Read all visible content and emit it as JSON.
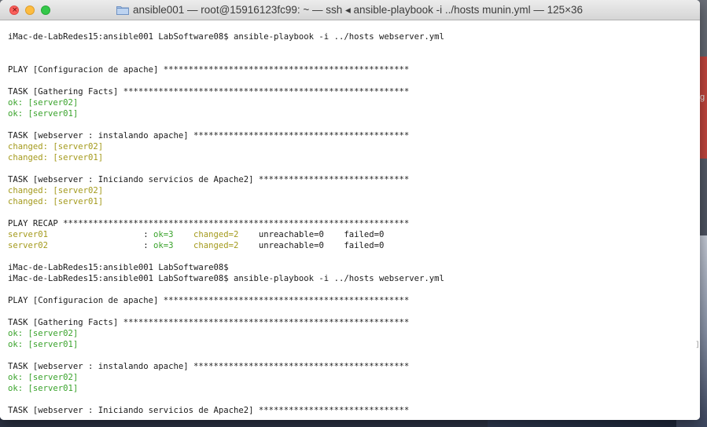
{
  "window": {
    "title": "ansible001 — root@15916123fc99: ~ — ssh ◂ ansible-playbook -i ../hosts munin.yml — 125×36",
    "close_glyph": "×"
  },
  "desktop": {
    "side_label": "g",
    "right_mark": "]"
  },
  "colors": {
    "ok": "#3aa32c",
    "changed": "#a49a1c",
    "text": "#1a1a1a"
  },
  "terminal": {
    "lines": [
      {
        "t": "iMac-de-LabRedes15:ansible001 LabSoftware08$ ansible-playbook -i ../hosts webserver.yml",
        "c": "plain"
      },
      {
        "t": "",
        "c": "plain"
      },
      {
        "t": "",
        "c": "plain"
      },
      {
        "t": "PLAY [Configuracion de apache] *************************************************",
        "c": "plain"
      },
      {
        "t": "",
        "c": "plain"
      },
      {
        "t": "TASK [Gathering Facts] *********************************************************",
        "c": "plain"
      },
      {
        "t": "ok: [server02]",
        "c": "ok"
      },
      {
        "t": "ok: [server01]",
        "c": "ok"
      },
      {
        "t": "",
        "c": "plain"
      },
      {
        "t": "TASK [webserver : instalando apache] *******************************************",
        "c": "plain"
      },
      {
        "t": "changed: [server02]",
        "c": "changed"
      },
      {
        "t": "changed: [server01]",
        "c": "changed"
      },
      {
        "t": "",
        "c": "plain"
      },
      {
        "t": "TASK [webserver : Iniciando servicios de Apache2] ******************************",
        "c": "plain"
      },
      {
        "t": "changed: [server02]",
        "c": "changed"
      },
      {
        "t": "changed: [server01]",
        "c": "changed"
      },
      {
        "t": "",
        "c": "plain"
      },
      {
        "t": "PLAY RECAP *********************************************************************",
        "c": "plain"
      },
      {
        "t": "RECAP1",
        "c": "recap"
      },
      {
        "t": "RECAP2",
        "c": "recap"
      },
      {
        "t": "",
        "c": "plain"
      },
      {
        "t": "iMac-de-LabRedes15:ansible001 LabSoftware08$",
        "c": "plain"
      },
      {
        "t": "iMac-de-LabRedes15:ansible001 LabSoftware08$ ansible-playbook -i ../hosts webserver.yml",
        "c": "plain"
      },
      {
        "t": "",
        "c": "plain"
      },
      {
        "t": "PLAY [Configuracion de apache] *************************************************",
        "c": "plain"
      },
      {
        "t": "",
        "c": "plain"
      },
      {
        "t": "TASK [Gathering Facts] *********************************************************",
        "c": "plain"
      },
      {
        "t": "ok: [server02]",
        "c": "ok"
      },
      {
        "t": "ok: [server01]",
        "c": "ok"
      },
      {
        "t": "",
        "c": "plain"
      },
      {
        "t": "TASK [webserver : instalando apache] *******************************************",
        "c": "plain"
      },
      {
        "t": "ok: [server02]",
        "c": "ok"
      },
      {
        "t": "ok: [server01]",
        "c": "ok"
      },
      {
        "t": "",
        "c": "plain"
      },
      {
        "t": "TASK [webserver : Iniciando servicios de Apache2] ******************************",
        "c": "plain"
      }
    ],
    "recap": [
      {
        "host": "server01",
        "sep": "                   : ",
        "ok": "ok=3",
        "changed": "changed=2",
        "unreachable": "unreachable=0",
        "failed": "failed=0"
      },
      {
        "host": "server02",
        "sep": "                   : ",
        "ok": "ok=3",
        "changed": "changed=2",
        "unreachable": "unreachable=0",
        "failed": "failed=0"
      }
    ]
  }
}
